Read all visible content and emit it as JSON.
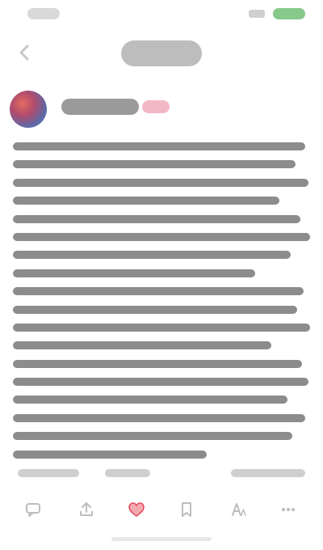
{
  "status_bar": {
    "time": "",
    "battery": ""
  },
  "nav": {
    "title": ""
  },
  "author": {
    "name": "",
    "badge": ""
  },
  "article": {
    "lines": [
      "",
      "",
      "",
      "",
      "",
      "",
      "",
      "",
      "",
      "",
      "",
      "",
      "",
      "",
      "",
      "",
      "",
      ""
    ]
  },
  "meta": {
    "left": "",
    "middle": "",
    "right": ""
  },
  "actions": [
    {
      "name": "comment-icon",
      "label": ""
    },
    {
      "name": "share-icon",
      "label": ""
    },
    {
      "name": "like-icon",
      "label": ""
    },
    {
      "name": "bookmark-icon",
      "label": ""
    },
    {
      "name": "font-icon",
      "label": ""
    },
    {
      "name": "more-icon",
      "label": ""
    }
  ],
  "colors": {
    "accent": "#e24b5b",
    "battery": "#86c98a",
    "text_blur": "#8c8c8c"
  }
}
